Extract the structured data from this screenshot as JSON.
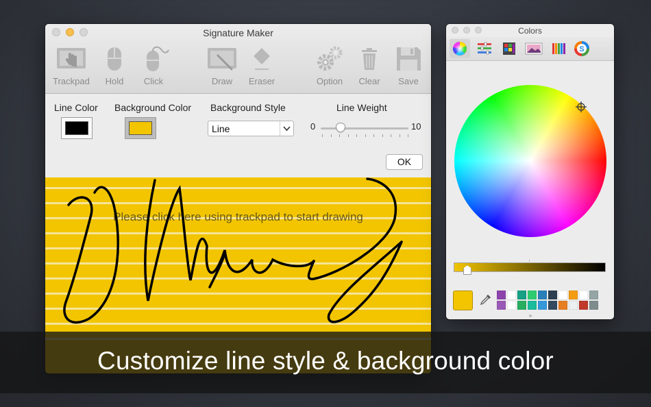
{
  "window": {
    "title": "Signature Maker",
    "toolbar": [
      {
        "label": "Trackpad",
        "icon": "trackpad-icon"
      },
      {
        "label": "Hold",
        "icon": "mouse-hold-icon"
      },
      {
        "label": "Click",
        "icon": "mouse-click-icon"
      },
      {
        "label": "Draw",
        "icon": "draw-icon"
      },
      {
        "label": "Eraser",
        "icon": "eraser-icon"
      },
      {
        "label": "Option",
        "icon": "gear-icon"
      },
      {
        "label": "Clear",
        "icon": "trash-icon"
      },
      {
        "label": "Save",
        "icon": "floppy-disk-icon"
      }
    ],
    "settings": {
      "line_color_label": "Line Color",
      "line_color_value": "#000000",
      "background_color_label": "Background Color",
      "background_color_value": "#f2c500",
      "background_style_label": "Background Style",
      "background_style_value": "Line",
      "line_weight_label": "Line Weight",
      "line_weight_min": "0",
      "line_weight_max": "10",
      "line_weight_value": 2,
      "ok_label": "OK"
    },
    "canvas": {
      "prompt": "Please click here using trackpad to start drawing",
      "background_color": "#f2c500"
    }
  },
  "colors_panel": {
    "title": "Colors",
    "tabs": [
      "color-wheel-icon",
      "color-sliders-icon",
      "color-palettes-icon",
      "image-palettes-icon",
      "pencils-icon",
      "custom-picker-icon"
    ],
    "current_color": "#f2c500",
    "swatches": [
      "#8e44ad",
      "#ffffff",
      "#16a085",
      "#2ecc71",
      "#2980b9",
      "#2c3e50",
      "#ffffff",
      "#f39c12",
      "#ffffff",
      "#95a5a6",
      "#9b59b6",
      "#ffffff",
      "#27ae60",
      "#1abc9c",
      "#3498db",
      "#34495e",
      "#e67e22",
      "#ecf0f1",
      "#c0392b",
      "#7f8c8d"
    ]
  },
  "caption": "Customize line style & background color"
}
